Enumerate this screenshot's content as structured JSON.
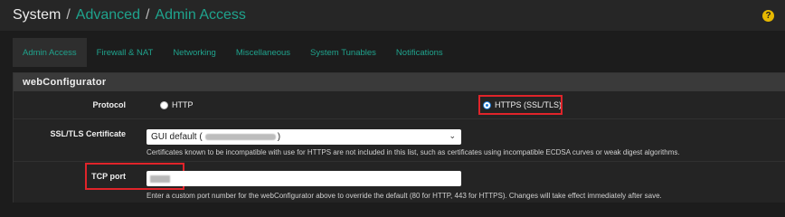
{
  "breadcrumb": {
    "root": "System",
    "sep1": "/",
    "advanced": "Advanced",
    "sep2": "/",
    "current": "Admin Access"
  },
  "help_icon": {
    "glyph": "?",
    "name": "help-icon"
  },
  "tabs": [
    {
      "label": "Admin Access",
      "active": true
    },
    {
      "label": "Firewall & NAT",
      "active": false
    },
    {
      "label": "Networking",
      "active": false
    },
    {
      "label": "Miscellaneous",
      "active": false
    },
    {
      "label": "System Tunables",
      "active": false
    },
    {
      "label": "Notifications",
      "active": false
    }
  ],
  "panel": {
    "title": "webConfigurator"
  },
  "protocol": {
    "label": "Protocol",
    "options": [
      {
        "label": "HTTP",
        "selected": false
      },
      {
        "label": "HTTPS (SSL/TLS)",
        "selected": true
      }
    ]
  },
  "ssl": {
    "label": "SSL/TLS Certificate",
    "select_prefix": "GUI default (",
    "select_suffix": ")",
    "help": "Certificates known to be incompatible with use for HTTPS are not included in this list, such as certificates using incompatible ECDSA curves or weak digest algorithms."
  },
  "tcp": {
    "label": "TCP port",
    "help": "Enter a custom port number for the webConfigurator above to override the default (80 for HTTP, 443 for HTTPS). Changes will take effect immediately after save."
  },
  "colors": {
    "accent": "#1fa38d",
    "highlight": "#e0242a",
    "help": "#e6b800"
  }
}
